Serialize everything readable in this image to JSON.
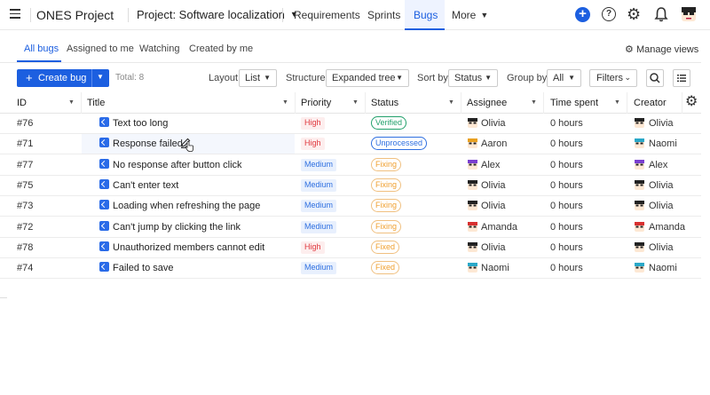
{
  "topnav": {
    "project_name": "ONES Project",
    "project_select": "Project: Software localization",
    "tabs": [
      "Requirements",
      "Sprints",
      "Bugs",
      "More"
    ],
    "active_tab": "Bugs"
  },
  "subtabs": {
    "items": [
      "All bugs",
      "Assigned to me",
      "Watching",
      "Created by me"
    ],
    "active": "All bugs",
    "manage_views": "Manage views"
  },
  "toolbar": {
    "create_label": "Create bug",
    "total": "Total: 8",
    "layout_label": "Layout",
    "layout_value": "List",
    "structure_label": "Structure",
    "structure_value": "Expanded tree",
    "sortby_label": "Sort by",
    "sortby_value": "Status",
    "groupby_label": "Group by",
    "groupby_value": "All",
    "filters_label": "Filters"
  },
  "table": {
    "headers": [
      "ID",
      "Title",
      "Priority",
      "Status",
      "Assignee",
      "Time spent",
      "Creator"
    ],
    "rows": [
      {
        "id": "#76",
        "title": "Text too long",
        "priority": "High",
        "status": "Verified",
        "assignee": "Olivia",
        "time": "0 hours",
        "creator": "Olivia"
      },
      {
        "id": "#71",
        "title": "Response failed",
        "priority": "High",
        "status": "Unprocessed",
        "assignee": "Aaron",
        "time": "0 hours",
        "creator": "Naomi"
      },
      {
        "id": "#77",
        "title": "No response after button click",
        "priority": "Medium",
        "status": "Fixing",
        "assignee": "Alex",
        "time": "0 hours",
        "creator": "Alex"
      },
      {
        "id": "#75",
        "title": "Can't enter text",
        "priority": "Medium",
        "status": "Fixing",
        "assignee": "Olivia",
        "time": "0 hours",
        "creator": "Olivia"
      },
      {
        "id": "#73",
        "title": "Loading when refreshing the page",
        "priority": "Medium",
        "status": "Fixing",
        "assignee": "Olivia",
        "time": "0 hours",
        "creator": "Olivia"
      },
      {
        "id": "#72",
        "title": "Can't jump by clicking the link",
        "priority": "Medium",
        "status": "Fixing",
        "assignee": "Amanda",
        "time": "0 hours",
        "creator": "Amanda"
      },
      {
        "id": "#78",
        "title": "Unauthorized members cannot edit",
        "priority": "High",
        "status": "Fixed",
        "assignee": "Olivia",
        "time": "0 hours",
        "creator": "Olivia"
      },
      {
        "id": "#74",
        "title": "Failed to save",
        "priority": "Medium",
        "status": "Fixed",
        "assignee": "Naomi",
        "time": "0 hours",
        "creator": "Naomi"
      }
    ]
  },
  "colors": {
    "accent": "#1c5fe0",
    "high": "#e0383e",
    "medium": "#2e6fe0",
    "verified": "#22a06b",
    "fixing": "#f0a030"
  }
}
